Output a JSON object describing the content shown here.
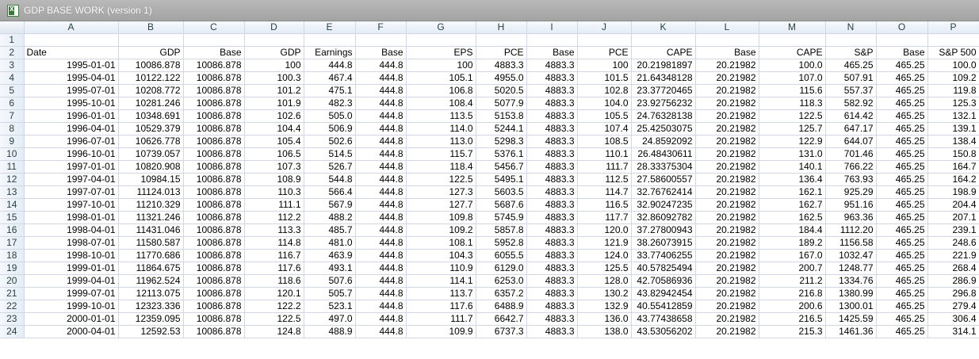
{
  "window": {
    "title": "GDP BASE WORK (version 1)"
  },
  "columns": [
    "A",
    "B",
    "C",
    "D",
    "E",
    "F",
    "G",
    "H",
    "I",
    "J",
    "K",
    "L",
    "M",
    "N",
    "O",
    "P"
  ],
  "headers": [
    "Date",
    "GDP",
    "Base",
    "GDP",
    "Earnings",
    "Base",
    "EPS",
    "PCE",
    "Base",
    "PCE",
    "CAPE",
    "Base",
    "CAPE",
    "S&P",
    "Base",
    "S&P 500"
  ],
  "rows": [
    [
      "1995-01-01",
      "10086.878",
      "10086.878",
      "100",
      "444.8",
      "444.8",
      "100",
      "4883.3",
      "4883.3",
      "100",
      "20.21981897",
      "20.21982",
      "100.0",
      "465.25",
      "465.25",
      "100.0"
    ],
    [
      "1995-04-01",
      "10122.122",
      "10086.878",
      "100.3",
      "467.4",
      "444.8",
      "105.1",
      "4955.0",
      "4883.3",
      "101.5",
      "21.64348128",
      "20.21982",
      "107.0",
      "507.91",
      "465.25",
      "109.2"
    ],
    [
      "1995-07-01",
      "10208.772",
      "10086.878",
      "101.2",
      "475.1",
      "444.8",
      "106.8",
      "5020.5",
      "4883.3",
      "102.8",
      "23.37720465",
      "20.21982",
      "115.6",
      "557.37",
      "465.25",
      "119.8"
    ],
    [
      "1995-10-01",
      "10281.246",
      "10086.878",
      "101.9",
      "482.3",
      "444.8",
      "108.4",
      "5077.9",
      "4883.3",
      "104.0",
      "23.92756232",
      "20.21982",
      "118.3",
      "582.92",
      "465.25",
      "125.3"
    ],
    [
      "1996-01-01",
      "10348.691",
      "10086.878",
      "102.6",
      "505.0",
      "444.8",
      "113.5",
      "5153.8",
      "4883.3",
      "105.5",
      "24.76328138",
      "20.21982",
      "122.5",
      "614.42",
      "465.25",
      "132.1"
    ],
    [
      "1996-04-01",
      "10529.379",
      "10086.878",
      "104.4",
      "506.9",
      "444.8",
      "114.0",
      "5244.1",
      "4883.3",
      "107.4",
      "25.42503075",
      "20.21982",
      "125.7",
      "647.17",
      "465.25",
      "139.1"
    ],
    [
      "1996-07-01",
      "10626.778",
      "10086.878",
      "105.4",
      "502.6",
      "444.8",
      "113.0",
      "5298.3",
      "4883.3",
      "108.5",
      "24.8592092",
      "20.21982",
      "122.9",
      "644.07",
      "465.25",
      "138.4"
    ],
    [
      "1996-10-01",
      "10739.057",
      "10086.878",
      "106.5",
      "514.5",
      "444.8",
      "115.7",
      "5376.1",
      "4883.3",
      "110.1",
      "26.48430611",
      "20.21982",
      "131.0",
      "701.46",
      "465.25",
      "150.8"
    ],
    [
      "1997-01-01",
      "10820.908",
      "10086.878",
      "107.3",
      "526.7",
      "444.8",
      "118.4",
      "5456.7",
      "4883.3",
      "111.7",
      "28.33375304",
      "20.21982",
      "140.1",
      "766.22",
      "465.25",
      "164.7"
    ],
    [
      "1997-04-01",
      "10984.15",
      "10086.878",
      "108.9",
      "544.8",
      "444.8",
      "122.5",
      "5495.1",
      "4883.3",
      "112.5",
      "27.58600557",
      "20.21982",
      "136.4",
      "763.93",
      "465.25",
      "164.2"
    ],
    [
      "1997-07-01",
      "11124.013",
      "10086.878",
      "110.3",
      "566.4",
      "444.8",
      "127.3",
      "5603.5",
      "4883.3",
      "114.7",
      "32.76762414",
      "20.21982",
      "162.1",
      "925.29",
      "465.25",
      "198.9"
    ],
    [
      "1997-10-01",
      "11210.329",
      "10086.878",
      "111.1",
      "567.9",
      "444.8",
      "127.7",
      "5687.6",
      "4883.3",
      "116.5",
      "32.90247235",
      "20.21982",
      "162.7",
      "951.16",
      "465.25",
      "204.4"
    ],
    [
      "1998-01-01",
      "11321.246",
      "10086.878",
      "112.2",
      "488.2",
      "444.8",
      "109.8",
      "5745.9",
      "4883.3",
      "117.7",
      "32.86092782",
      "20.21982",
      "162.5",
      "963.36",
      "465.25",
      "207.1"
    ],
    [
      "1998-04-01",
      "11431.046",
      "10086.878",
      "113.3",
      "485.7",
      "444.8",
      "109.2",
      "5857.8",
      "4883.3",
      "120.0",
      "37.27800943",
      "20.21982",
      "184.4",
      "1112.20",
      "465.25",
      "239.1"
    ],
    [
      "1998-07-01",
      "11580.587",
      "10086.878",
      "114.8",
      "481.0",
      "444.8",
      "108.1",
      "5952.8",
      "4883.3",
      "121.9",
      "38.26073915",
      "20.21982",
      "189.2",
      "1156.58",
      "465.25",
      "248.6"
    ],
    [
      "1998-10-01",
      "11770.686",
      "10086.878",
      "116.7",
      "463.9",
      "444.8",
      "104.3",
      "6055.5",
      "4883.3",
      "124.0",
      "33.77406255",
      "20.21982",
      "167.0",
      "1032.47",
      "465.25",
      "221.9"
    ],
    [
      "1999-01-01",
      "11864.675",
      "10086.878",
      "117.6",
      "493.1",
      "444.8",
      "110.9",
      "6129.0",
      "4883.3",
      "125.5",
      "40.57825494",
      "20.21982",
      "200.7",
      "1248.77",
      "465.25",
      "268.4"
    ],
    [
      "1999-04-01",
      "11962.524",
      "10086.878",
      "118.6",
      "507.6",
      "444.8",
      "114.1",
      "6253.0",
      "4883.3",
      "128.0",
      "42.70586936",
      "20.21982",
      "211.2",
      "1334.76",
      "465.25",
      "286.9"
    ],
    [
      "1999-07-01",
      "12113.075",
      "10086.878",
      "120.1",
      "505.7",
      "444.8",
      "113.7",
      "6357.2",
      "4883.3",
      "130.2",
      "43.82942454",
      "20.21982",
      "216.8",
      "1380.99",
      "465.25",
      "296.8"
    ],
    [
      "1999-10-01",
      "12323.336",
      "10086.878",
      "122.2",
      "523.1",
      "444.8",
      "117.6",
      "6488.9",
      "4883.3",
      "132.9",
      "40.55412859",
      "20.21982",
      "200.6",
      "1300.01",
      "465.25",
      "279.4"
    ],
    [
      "2000-01-01",
      "12359.095",
      "10086.878",
      "122.5",
      "497.0",
      "444.8",
      "111.7",
      "6642.7",
      "4883.3",
      "136.0",
      "43.77438658",
      "20.21982",
      "216.5",
      "1425.59",
      "465.25",
      "306.4"
    ],
    [
      "2000-04-01",
      "12592.53",
      "10086.878",
      "124.8",
      "488.9",
      "444.8",
      "109.9",
      "6737.3",
      "4883.3",
      "138.0",
      "43.53056202",
      "20.21982",
      "215.3",
      "1461.36",
      "465.25",
      "314.1"
    ]
  ]
}
